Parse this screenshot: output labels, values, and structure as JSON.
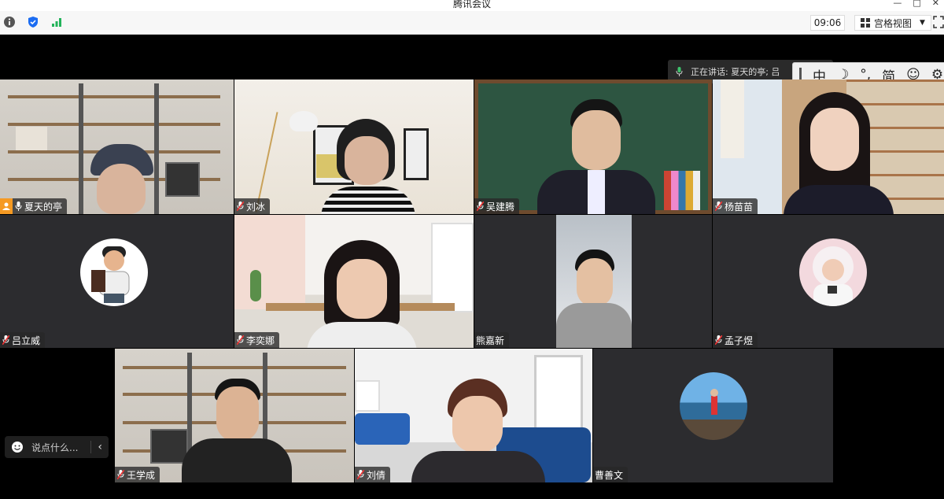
{
  "window": {
    "title": "腾讯会议",
    "controls": [
      "—",
      "□",
      "✕"
    ]
  },
  "toolbar": {
    "icons": [
      "info-icon",
      "shield-icon",
      "signal-icon"
    ],
    "time": "09:06",
    "view_label": "宫格视图",
    "view_dropdown_icon": "chevron-down-icon",
    "fullscreen_icon": "fullscreen-icon"
  },
  "speaking": {
    "text": "正在讲话: 夏天的亭; 吕"
  },
  "ime": {
    "items": [
      "中",
      "☽",
      "°,",
      "简",
      "☺",
      "⚙"
    ]
  },
  "participants": [
    {
      "name": "夏天的亭",
      "host": true
    },
    {
      "name": "刘冰"
    },
    {
      "name": "吴建腾"
    },
    {
      "name": "杨苗苗"
    },
    {
      "name": "吕立威"
    },
    {
      "name": "李奕娜"
    },
    {
      "name": "熊嘉新"
    },
    {
      "name": "孟子煜"
    },
    {
      "name": "王学成"
    },
    {
      "name": "刘倩"
    },
    {
      "name": "曹善文"
    }
  ],
  "chat": {
    "placeholder": "说点什么..."
  },
  "colors": {
    "accent": "#1b6cf2",
    "tile_bg": "#2c2c2f",
    "host_badge": "#f59a23"
  }
}
